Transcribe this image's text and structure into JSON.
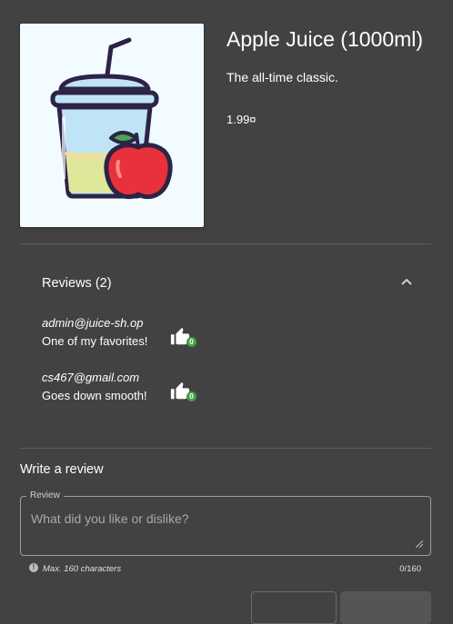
{
  "product": {
    "name": "Apple Juice (1000ml)",
    "description": "The all-time classic.",
    "price": "1.99¤",
    "image_icon": "apple-juice-cup-illustration"
  },
  "reviews": {
    "header": "Reviews (2)",
    "items": [
      {
        "author": "admin@juice-sh.op",
        "text": "One of my favorites!",
        "likes": "0"
      },
      {
        "author": "cs467@gmail.com",
        "text": "Goes down smooth!",
        "likes": "0"
      }
    ]
  },
  "write_review": {
    "title": "Write a review",
    "field_label": "Review",
    "placeholder": "What did you like or dislike?",
    "hint": "Max. 160 characters",
    "counter": "0/160"
  },
  "colors": {
    "background": "#424242",
    "like_badge": "#43a047"
  }
}
